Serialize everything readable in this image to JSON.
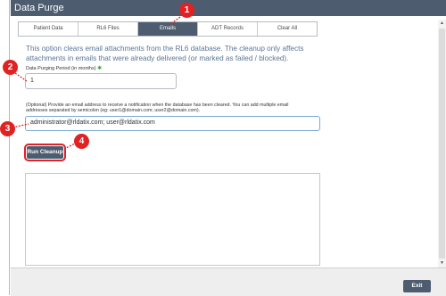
{
  "window": {
    "title": "Data Purge"
  },
  "tabs": [
    {
      "label": "Patient Data"
    },
    {
      "label": "RL6 Files"
    },
    {
      "label": "Emails"
    },
    {
      "label": "ADT Records"
    },
    {
      "label": "Clear All"
    }
  ],
  "description": "This option clears email attachments from the RL6 database. The cleanup only affects attachments in emails that were already delivered (or marked as failed / blocked).",
  "purge_period": {
    "label": "Data Purging Period (in months)",
    "required_mark": "✱",
    "value": "1"
  },
  "notification": {
    "label": "(Optional) Provide an email address to receive a notification when the database has been cleared. You can add multiple email addresses separated by semicolon (eg: user1@domain.com; user2@domain.com).",
    "value": "administrator@rldatix.com; user@rldatix.com"
  },
  "run_button": "Run Cleanup",
  "exit_button": "Exit",
  "markers": [
    "1",
    "2",
    "3",
    "4"
  ],
  "colors": {
    "header": "#4d5d6f",
    "marker": "#e02222",
    "description_text": "#5b7694"
  }
}
